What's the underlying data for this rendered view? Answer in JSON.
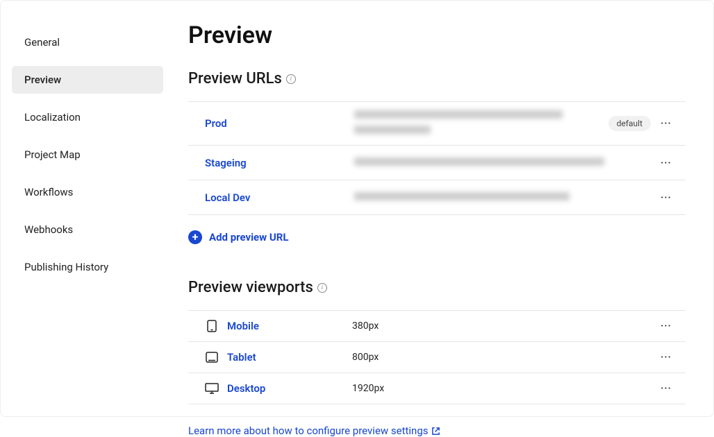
{
  "sidebar": {
    "items": [
      {
        "label": "General",
        "active": false
      },
      {
        "label": "Preview",
        "active": true
      },
      {
        "label": "Localization",
        "active": false
      },
      {
        "label": "Project Map",
        "active": false
      },
      {
        "label": "Workflows",
        "active": false
      },
      {
        "label": "Webhooks",
        "active": false
      },
      {
        "label": "Publishing History",
        "active": false
      }
    ]
  },
  "page": {
    "title": "Preview"
  },
  "previewUrls": {
    "heading": "Preview URLs",
    "addLabel": "Add preview URL",
    "defaultBadge": "default",
    "rows": [
      {
        "name": "Prod",
        "isDefault": true
      },
      {
        "name": "Stageing",
        "isDefault": false
      },
      {
        "name": "Local Dev",
        "isDefault": false
      }
    ]
  },
  "viewports": {
    "heading": "Preview viewports",
    "rows": [
      {
        "name": "Mobile",
        "size": "380px",
        "icon": "mobile"
      },
      {
        "name": "Tablet",
        "size": "800px",
        "icon": "tablet"
      },
      {
        "name": "Desktop",
        "size": "1920px",
        "icon": "desktop"
      }
    ]
  },
  "learnMore": "Learn more about how to configure preview settings"
}
